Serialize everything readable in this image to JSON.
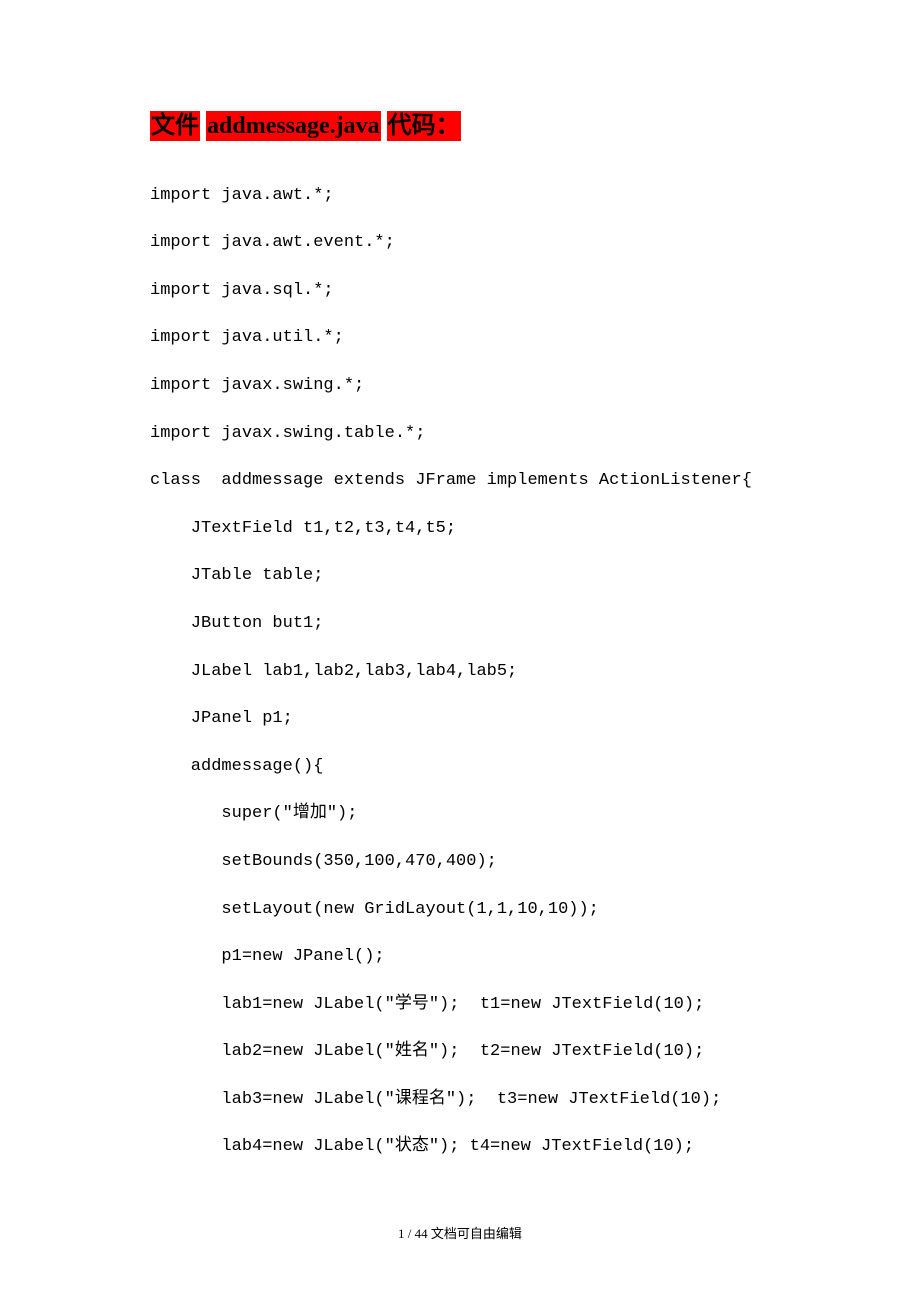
{
  "heading": {
    "part1": "文件",
    "part2": "addmessage.java",
    "part3": "代码："
  },
  "code_lines": [
    "import java.awt.*;",
    "import java.awt.event.*;",
    "import java.sql.*;",
    "import java.util.*;",
    "import javax.swing.*;",
    "import javax.swing.table.*;",
    "class  addmessage extends JFrame implements ActionListener{",
    "    JTextField t1,t2,t3,t4,t5;",
    "    JTable table;",
    "    JButton but1;",
    "    JLabel lab1,lab2,lab3,lab4,lab5;",
    "    JPanel p1;",
    "    addmessage(){",
    "       super(\"增加\");",
    "       setBounds(350,100,470,400);",
    "       setLayout(new GridLayout(1,1,10,10));",
    "       p1=new JPanel();",
    "       lab1=new JLabel(\"学号\");  t1=new JTextField(10);",
    "       lab2=new JLabel(\"姓名\");  t2=new JTextField(10);",
    "       lab3=new JLabel(\"课程名\");  t3=new JTextField(10);",
    "       lab4=new JLabel(\"状态\"); t4=new JTextField(10);"
  ],
  "footer": {
    "page_info": "1 / 44",
    "note": "文档可自由编辑"
  }
}
